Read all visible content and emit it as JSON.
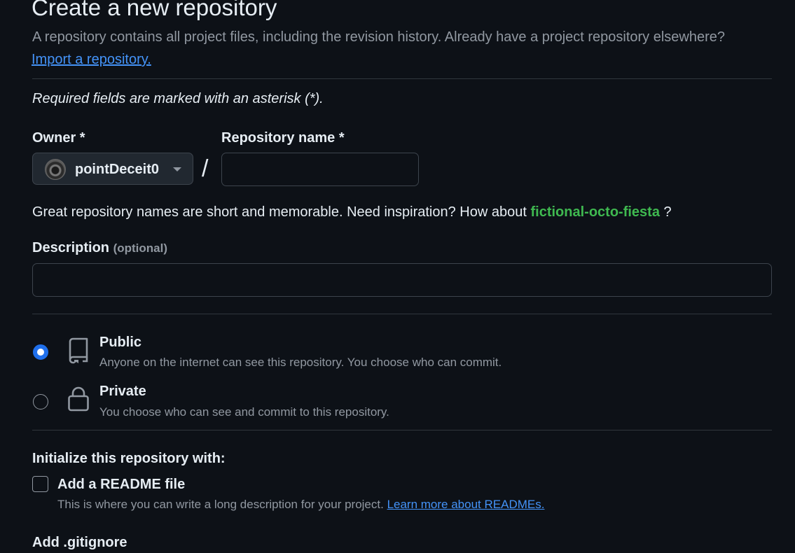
{
  "header": {
    "title": "Create a new repository",
    "intro": "A repository contains all project files, including the revision history. Already have a project repository elsewhere?",
    "import_link": "Import a repository."
  },
  "form": {
    "required_note": "Required fields are marked with an asterisk (*).",
    "owner_label": "Owner *",
    "owner_value": "pointDeceit0",
    "slash": "/",
    "repo_name_label": "Repository name *",
    "repo_name_value": "",
    "name_hint_prefix": "Great repository names are short and memorable. Need inspiration? How about",
    "name_suggestion": "fictional-octo-fiesta",
    "name_hint_suffix": "?",
    "description_label": "Description",
    "description_optional": "(optional)",
    "description_value": ""
  },
  "visibility": {
    "public_title": "Public",
    "public_desc": "Anyone on the internet can see this repository. You choose who can commit.",
    "public_icon": "repo-book-icon",
    "private_title": "Private",
    "private_desc": "You choose who can see and commit to this repository.",
    "private_icon": "lock-icon",
    "selected": "public"
  },
  "initialize": {
    "heading": "Initialize this repository with:",
    "readme_label": "Add a README file",
    "readme_checked": false,
    "readme_desc": "This is where you can write a long description for your project.",
    "readme_link": "Learn more about READMEs.",
    "gitignore_label": "Add .gitignore"
  },
  "colors": {
    "background": "#0d1117",
    "link": "#4493f8",
    "suggestion": "#3fb950",
    "radio_accent": "#1f6feb"
  }
}
